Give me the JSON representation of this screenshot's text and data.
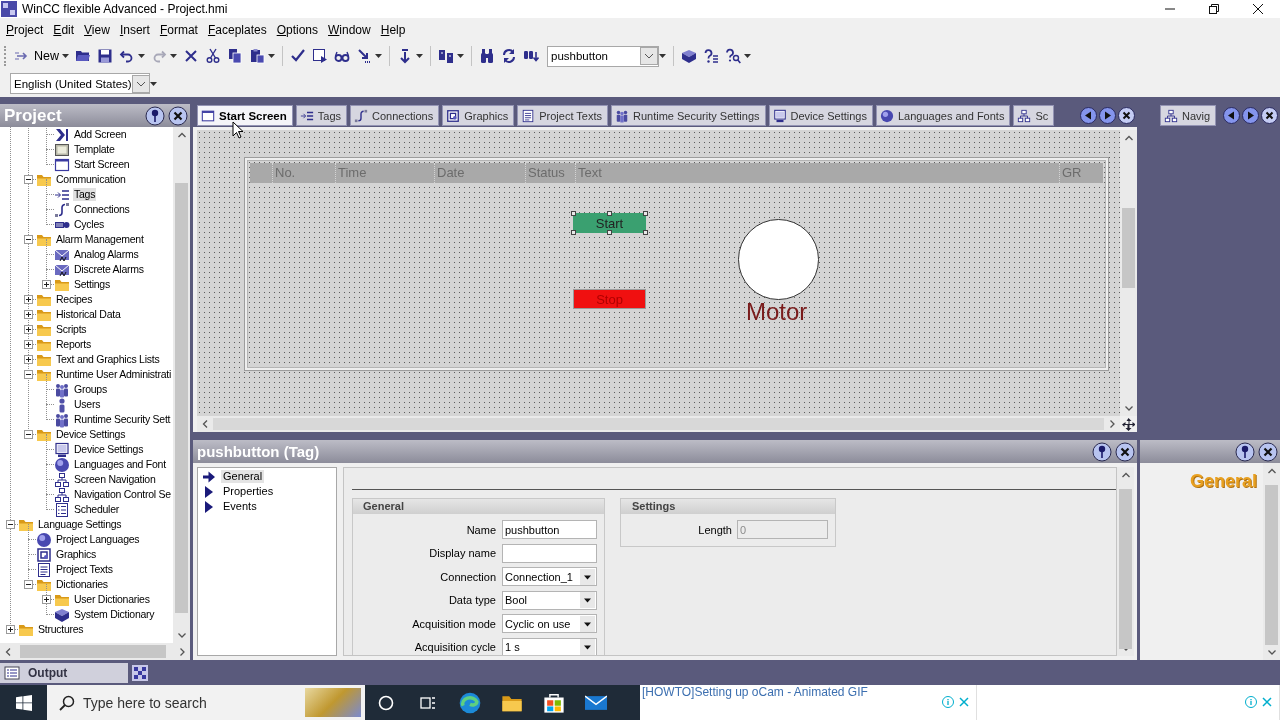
{
  "title_bar": {
    "title": "WinCC flexible Advanced - Project.hmi"
  },
  "menu": [
    "Project",
    "Edit",
    "View",
    "Insert",
    "Format",
    "Faceplates",
    "Options",
    "Window",
    "Help"
  ],
  "toolbar": {
    "new_button": "New",
    "undo_button": {
      "disabled": false
    },
    "redo_button": {
      "disabled": true
    },
    "find_combo": "pushbutton"
  },
  "language_bar": {
    "language_combo": "English (United States)"
  },
  "project_panel": {
    "title": "Project",
    "tree": [
      {
        "children": [
          {
            "children": [
              {
                "label": "Add Screen",
                "kind": "add",
                "selected": false
              },
              {
                "label": "Template",
                "kind": "template",
                "selected": false
              },
              {
                "label": "Start Screen",
                "kind": "screen",
                "selected": false
              }
            ]
          },
          {
            "label": "Communication",
            "kind": "folder",
            "selected": false,
            "expanded": true,
            "children": [
              {
                "label": "Tags",
                "kind": "tags",
                "selected": true
              },
              {
                "label": "Connections",
                "kind": "connection",
                "selected": false
              },
              {
                "label": "Cycles",
                "kind": "cycle",
                "selected": false
              }
            ]
          },
          {
            "label": "Alarm Management",
            "kind": "folder",
            "selected": false,
            "expanded": true,
            "children": [
              {
                "label": "Analog Alarms",
                "kind": "alarm",
                "selected": false
              },
              {
                "label": "Discrete Alarms",
                "kind": "alarm",
                "selected": false
              },
              {
                "label": "Settings",
                "kind": "folder",
                "selected": false,
                "expanded": false
              }
            ]
          },
          {
            "label": "Recipes",
            "kind": "folder",
            "selected": false,
            "expanded": false
          },
          {
            "label": "Historical Data",
            "kind": "folder",
            "selected": false,
            "expanded": false
          },
          {
            "label": "Scripts",
            "kind": "folder",
            "selected": false,
            "expanded": false
          },
          {
            "label": "Reports",
            "kind": "folder",
            "selected": false,
            "expanded": false
          },
          {
            "label": "Text and Graphics Lists",
            "kind": "folder",
            "selected": false,
            "expanded": false
          },
          {
            "label": "Runtime User Administrati",
            "kind": "folder",
            "selected": false,
            "expanded": true,
            "children": [
              {
                "label": "Groups",
                "kind": "users",
                "selected": false
              },
              {
                "label": "Users",
                "kind": "user",
                "selected": false
              },
              {
                "label": "Runtime Security Sett",
                "kind": "users",
                "selected": false
              }
            ]
          },
          {
            "label": "Device Settings",
            "kind": "folder",
            "selected": false,
            "expanded": true,
            "children": [
              {
                "label": "Device Settings",
                "kind": "device",
                "selected": false
              },
              {
                "label": "Languages and Font",
                "kind": "globe",
                "selected": false
              },
              {
                "label": "Screen Navigation",
                "kind": "navigation",
                "selected": false
              },
              {
                "label": "Navigation Control Se",
                "kind": "navigation",
                "selected": false
              },
              {
                "label": "Scheduler",
                "kind": "list",
                "selected": false
              }
            ]
          }
        ]
      },
      {
        "label": "Language Settings",
        "kind": "folder",
        "selected": false,
        "expanded": true,
        "children": [
          {
            "label": "Project Languages",
            "kind": "globe",
            "selected": false
          },
          {
            "label": "Graphics",
            "kind": "graphics",
            "selected": false
          },
          {
            "label": "Project Texts",
            "kind": "text",
            "selected": false
          },
          {
            "label": "Dictionaries",
            "kind": "folder",
            "selected": false,
            "expanded": true,
            "children": [
              {
                "label": "User Dictionaries",
                "kind": "folder",
                "selected": false,
                "expanded": false
              },
              {
                "label": "System Dictionary",
                "kind": "book",
                "selected": false
              }
            ]
          }
        ]
      },
      {
        "label": "Structures",
        "kind": "folder",
        "selected": false,
        "expanded": false
      }
    ]
  },
  "editor_tabs": [
    {
      "label": "Start Screen",
      "kind": "screen",
      "selected": true
    },
    {
      "label": "Tags",
      "kind": "tags",
      "selected": false
    },
    {
      "label": "Connections",
      "kind": "connection",
      "selected": false
    },
    {
      "label": "Graphics",
      "kind": "graphics",
      "selected": false
    },
    {
      "label": "Project Texts",
      "kind": "text",
      "selected": false
    },
    {
      "label": "Runtime Security Settings",
      "kind": "users",
      "selected": false
    },
    {
      "label": "Device Settings",
      "kind": "device",
      "selected": false
    },
    {
      "label": "Languages and Fonts",
      "kind": "globe",
      "selected": false
    },
    {
      "label": "Sc",
      "kind": "navigation",
      "selected": false
    }
  ],
  "side_tabs": [
    {
      "label": "Navig",
      "kind": "navigation",
      "selected": false
    }
  ],
  "screen": {
    "alarm_view": {
      "columns": [
        "No.",
        "Time",
        "Date",
        "Status",
        "Text",
        "GR"
      ]
    },
    "objects": [
      {
        "kind": "button",
        "label": "Start",
        "color": "#3aa070",
        "selected": true
      },
      {
        "kind": "button",
        "label": "Stop",
        "color": "#f01010",
        "selected": false
      },
      {
        "kind": "circle",
        "color": "#ffffff",
        "selected": false
      },
      {
        "kind": "text",
        "label": "Motor",
        "color": "#7a1c1c",
        "selected": false
      }
    ]
  },
  "properties_panel": {
    "title": "pushbutton (Tag)",
    "nav": [
      {
        "label": "General",
        "selected": true
      },
      {
        "label": "Properties",
        "selected": false
      },
      {
        "label": "Events",
        "selected": false
      }
    ],
    "groups": [
      {
        "title": "General",
        "fields": [
          {
            "label": "Name",
            "kind": "text",
            "value": "pushbutton",
            "disabled": false
          },
          {
            "label": "Display name",
            "kind": "text",
            "disabled": false
          },
          {
            "label": "Connection",
            "kind": "dropdown",
            "value": "Connection_1",
            "disabled": false
          },
          {
            "label": "Data type",
            "kind": "dropdown",
            "value": "Bool",
            "disabled": false
          },
          {
            "label": "Acquisition mode",
            "kind": "dropdown",
            "value": "Cyclic on use",
            "disabled": false
          },
          {
            "label": "Acquisition cycle",
            "kind": "dropdown",
            "value": "1 s",
            "disabled": false
          }
        ]
      },
      {
        "title": "Settings",
        "fields": [
          {
            "label": "Length",
            "kind": "text",
            "value": "0",
            "disabled": true
          }
        ]
      }
    ]
  },
  "help_panel": {
    "heading": "General"
  },
  "output_bar": {
    "label": "Output"
  },
  "taskbar": {
    "search_placeholder": "Type here to search"
  },
  "ad_bar": {
    "slots": [
      {
        "kind": "text_ad",
        "link": "[HOWTO]Setting up oCam - Animated GIF"
      },
      {
        "kind": "blank_ad"
      }
    ]
  }
}
